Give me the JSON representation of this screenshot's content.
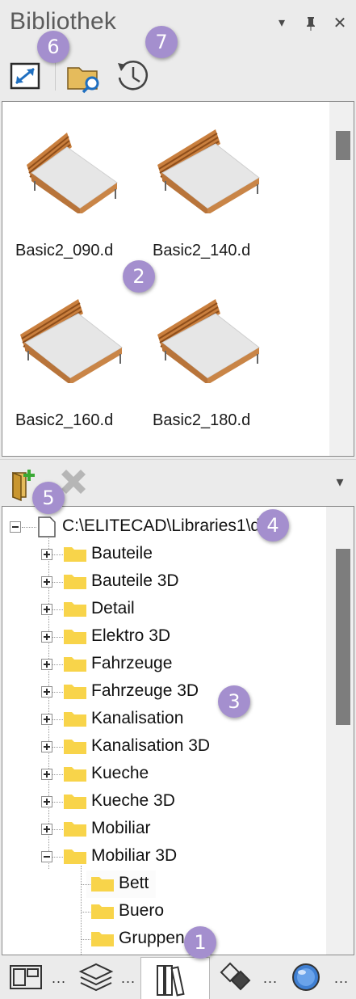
{
  "panel": {
    "title": "Bibliothek",
    "controls": {
      "dropdown": "▾",
      "pin": "⊥",
      "close": "✕"
    }
  },
  "toolbar": {
    "items": [
      {
        "icon": "resize-view-icon"
      },
      {
        "icon": "folder-search-icon"
      },
      {
        "icon": "history-clock-icon"
      }
    ]
  },
  "preview": {
    "items": [
      {
        "label": "Basic2_090.d",
        "icon": "single-bed-thumbnail"
      },
      {
        "label": "Basic2_140.d",
        "icon": "double-bed-thumbnail"
      },
      {
        "label": "Basic2_160.d",
        "icon": "double-bed-thumbnail"
      },
      {
        "label": "Basic2_180.d",
        "icon": "double-bed-thumbnail"
      }
    ]
  },
  "tree_toolbar": {
    "items": [
      {
        "icon": "add-library-icon"
      },
      {
        "icon": "remove-x-icon"
      }
    ],
    "menu_arrow": "▾"
  },
  "tree": {
    "root": "C:\\ELITECAD\\Libraries1\\de",
    "items": [
      {
        "label": "Bauteile",
        "state": "collapsed"
      },
      {
        "label": "Bauteile 3D",
        "state": "collapsed"
      },
      {
        "label": "Detail",
        "state": "collapsed"
      },
      {
        "label": "Elektro 3D",
        "state": "collapsed"
      },
      {
        "label": "Fahrzeuge",
        "state": "collapsed"
      },
      {
        "label": "Fahrzeuge 3D",
        "state": "collapsed"
      },
      {
        "label": "Kanalisation",
        "state": "collapsed"
      },
      {
        "label": "Kanalisation 3D",
        "state": "collapsed"
      },
      {
        "label": "Kueche",
        "state": "collapsed"
      },
      {
        "label": "Kueche 3D",
        "state": "collapsed"
      },
      {
        "label": "Mobiliar",
        "state": "collapsed"
      },
      {
        "label": "Mobiliar 3D",
        "state": "expanded"
      }
    ],
    "children": [
      {
        "label": "Bett",
        "selected": true
      },
      {
        "label": "Buero"
      },
      {
        "label": "Gruppen"
      }
    ]
  },
  "bottom_tabs": [
    {
      "icon": "layout-panels-icon",
      "more": "..."
    },
    {
      "icon": "layers-icon",
      "more": "..."
    },
    {
      "icon": "library-books-icon",
      "active": true
    },
    {
      "icon": "diamonds-icon",
      "more": "..."
    },
    {
      "icon": "globe-icon",
      "more": "..."
    }
  ],
  "annotations": [
    "1",
    "2",
    "3",
    "4",
    "5",
    "6",
    "7"
  ],
  "colors": {
    "badge": "#a48fce",
    "folder": "#f8d44a",
    "scroll_thumb": "#7d7d7d"
  }
}
